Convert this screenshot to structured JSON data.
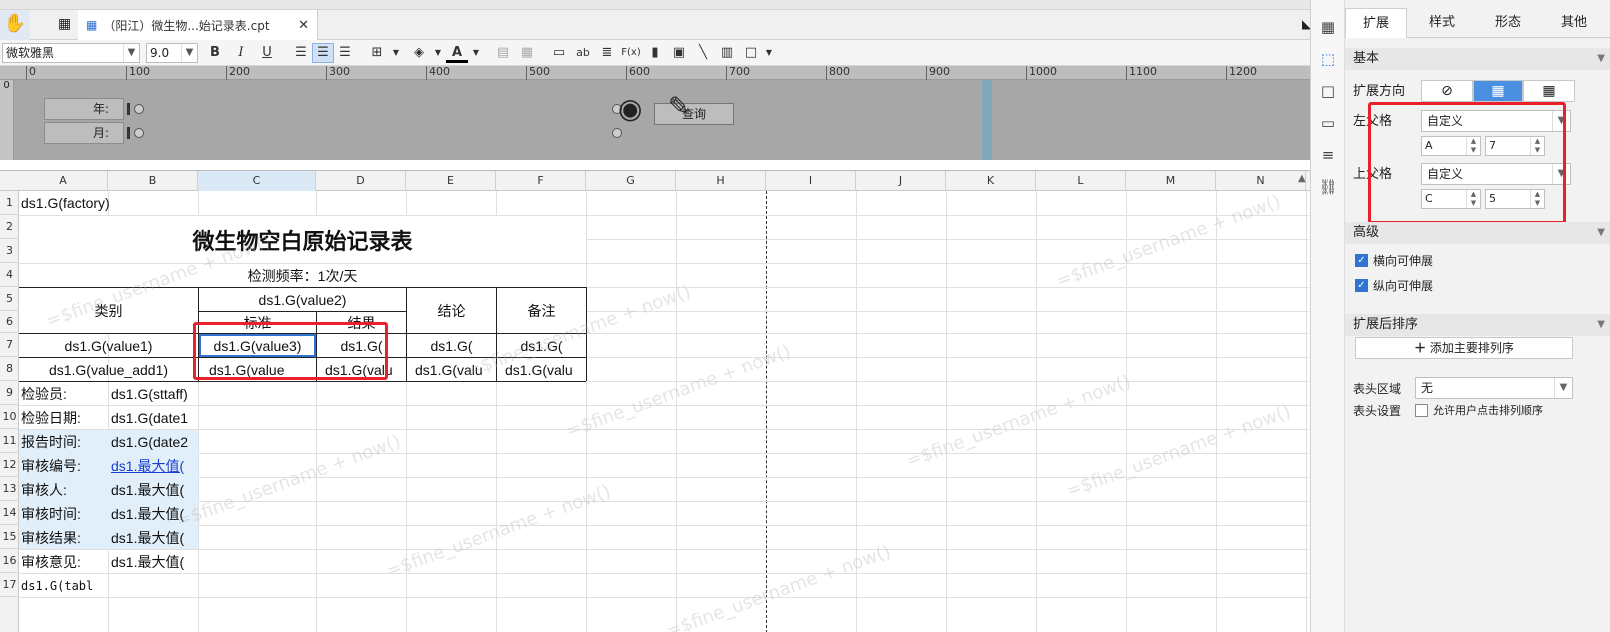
{
  "tabbar": {
    "tab_title": "（阳江）微生物...始记录表.cpt"
  },
  "toolbar": {
    "font_name": "微软雅黑",
    "font_size": "9.0",
    "bold": "B",
    "italic": "I",
    "underline": "U",
    "abc": "ab",
    "fx": "F(x)"
  },
  "ruler": {
    "ticks": [
      "0",
      "100",
      "200",
      "300",
      "400",
      "500",
      "600",
      "700",
      "800",
      "900",
      "1000",
      "1100",
      "1200"
    ],
    "vtick": "0"
  },
  "params": {
    "year_label": "年:",
    "month_label": "月:",
    "query_label": "查询"
  },
  "grid": {
    "columns": [
      "A",
      "B",
      "C",
      "D",
      "E",
      "F",
      "G",
      "H",
      "I",
      "J",
      "K",
      "L",
      "M",
      "N"
    ],
    "rows": [
      "1",
      "2",
      "3",
      "4",
      "5",
      "6",
      "7",
      "8",
      "9",
      "10",
      "11",
      "12",
      "13",
      "14",
      "15",
      "16",
      "17"
    ],
    "r1": "ds1.G(factory)",
    "title": "微生物空白原始记录表",
    "freq": "检测频率：1次/天",
    "h_category": "类别",
    "h_value2": "ds1.G(value2)",
    "h_standard": "标准",
    "h_result": "结果",
    "h_conclusion": "结论",
    "h_remark": "备注",
    "r7": [
      "ds1.G(value1)",
      "ds1.G(value3)",
      "ds1.G(",
      "ds1.G(",
      "ds1.G("
    ],
    "r8": [
      "ds1.G(value_add1)",
      "ds1.G(value_",
      "ds1.G(valu",
      "ds1.G(valu",
      "ds1.G(valu"
    ],
    "labels": [
      "检验员:",
      "检验日期:",
      "报告时间:",
      "审核编号:",
      "审核人:",
      "审核时间:",
      "审核结果:",
      "审核意见:"
    ],
    "values": [
      "ds1.G(sttaff)",
      "ds1.G(date1",
      "ds1.G(date2",
      "ds1.最大值(",
      "ds1.最大值(",
      "ds1.最大值(",
      "ds1.最大值(",
      "ds1.最大值("
    ],
    "r17": "ds1.G(tabl",
    "watermark": "=$fine_username + now()"
  },
  "panel": {
    "tabs": [
      "扩展",
      "样式",
      "形态",
      "其他"
    ],
    "basic": "基本",
    "expand_dir": "扩展方向",
    "left_parent": "左父格",
    "left_mode": "自定义",
    "left_col": "A",
    "left_row": "7",
    "top_parent": "上父格",
    "top_mode": "自定义",
    "top_col": "C",
    "top_row": "5",
    "advanced": "高级",
    "h_extend": "横向可伸展",
    "v_extend": "纵向可伸展",
    "sort_title": "扩展后排序",
    "add_sort": "添加主要排列序",
    "header_area_label": "表头区域",
    "header_area_value": "无",
    "header_setting_label": "表头设置",
    "header_setting_option": "允许用户点击排列顺序"
  }
}
